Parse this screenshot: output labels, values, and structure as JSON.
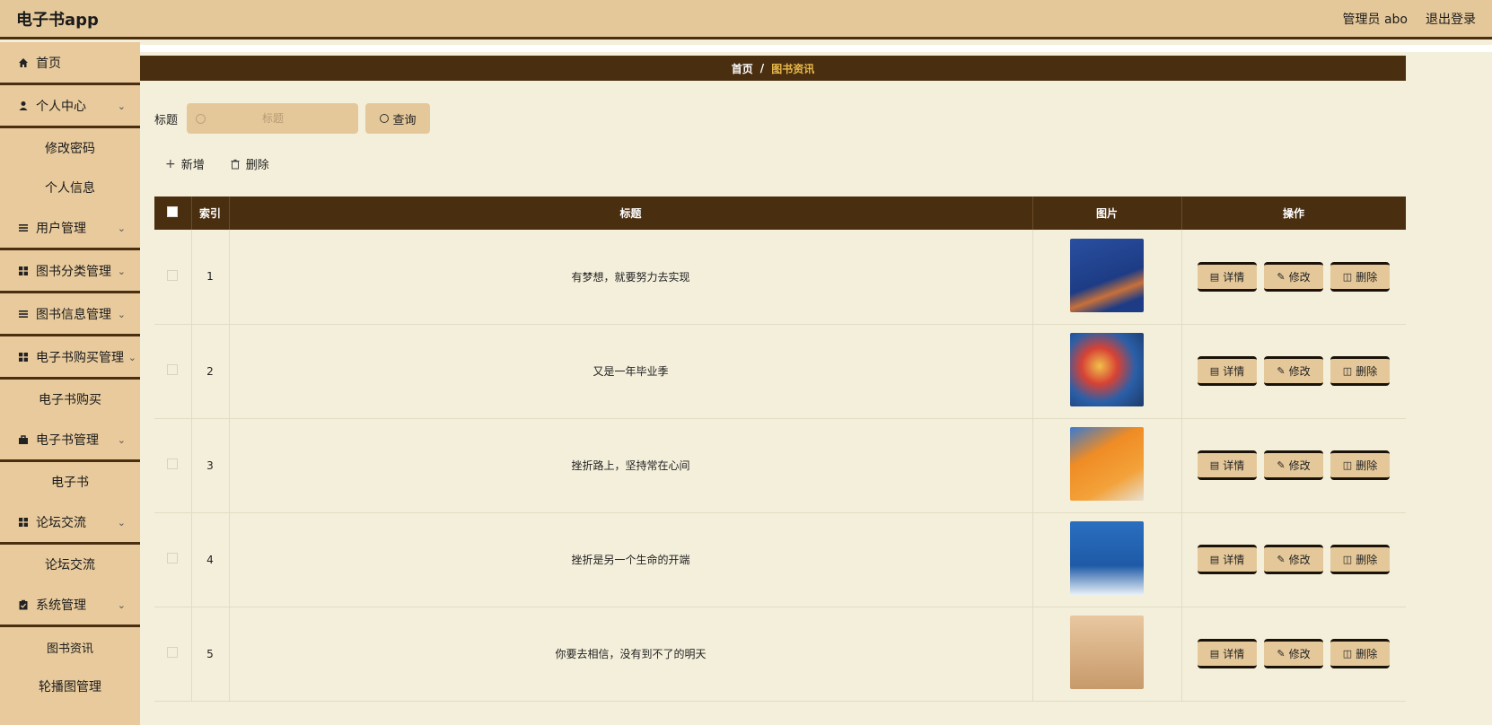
{
  "header": {
    "app_title": "电子书app",
    "user_label": "管理员 abo",
    "logout_label": "退出登录"
  },
  "sidebar": {
    "home": "首页",
    "personal_center": "个人中心",
    "change_password": "修改密码",
    "personal_info": "个人信息",
    "user_mgmt": "用户管理",
    "book_category_mgmt": "图书分类管理",
    "book_info_mgmt": "图书信息管理",
    "ebook_purchase_mgmt": "电子书购买管理",
    "ebook_purchase": "电子书购买",
    "ebook_mgmt": "电子书管理",
    "ebook": "电子书",
    "forum": "论坛交流",
    "forum_sub": "论坛交流",
    "system_mgmt": "系统管理",
    "book_news": "图书资讯",
    "carousel_mgmt": "轮播图管理"
  },
  "breadcrumb": {
    "home": "首页",
    "separator": "/",
    "current": "图书资讯"
  },
  "search": {
    "label": "标题",
    "placeholder": "标题",
    "query_button": "查询"
  },
  "actions": {
    "add": "新增",
    "delete": "删除"
  },
  "table": {
    "columns": {
      "index": "索引",
      "title": "标题",
      "image": "图片",
      "operations": "操作"
    },
    "rows": [
      {
        "index": "1",
        "title": "有梦想，就要努力去实现"
      },
      {
        "index": "2",
        "title": "又是一年毕业季"
      },
      {
        "index": "3",
        "title": "挫折路上，坚持常在心间"
      },
      {
        "index": "4",
        "title": "挫折是另一个生命的开端"
      },
      {
        "index": "5",
        "title": "你要去相信，没有到不了的明天"
      }
    ],
    "op_labels": {
      "detail": "详情",
      "edit": "修改",
      "delete": "删除"
    }
  },
  "colors": {
    "header_bg": "#e5c89a",
    "dark_brown": "#4a2e10",
    "content_bg": "#f4efda",
    "accent_gold": "#e8b84a"
  }
}
